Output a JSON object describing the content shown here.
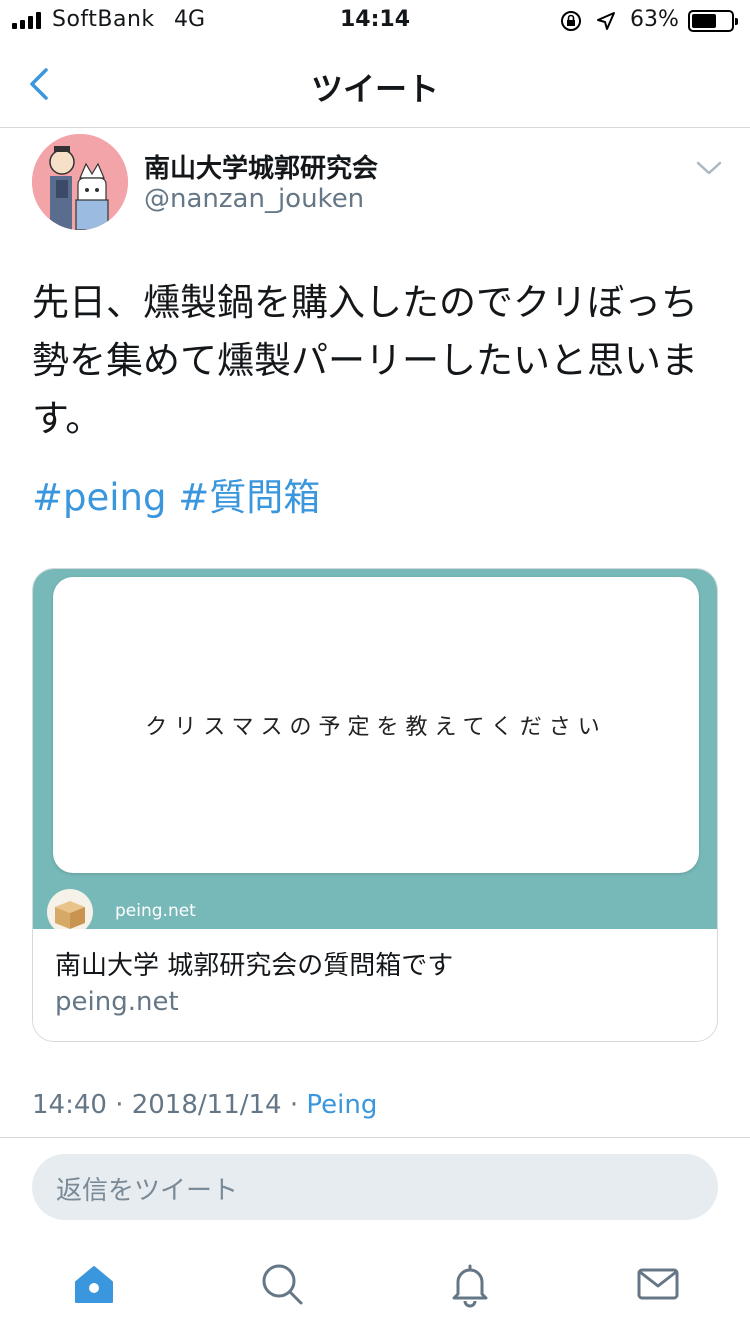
{
  "status_bar": {
    "carrier": "SoftBank",
    "network": "4G",
    "time": "14:14",
    "battery_percent": "63%",
    "battery_level": 0.63
  },
  "nav": {
    "title": "ツイート",
    "back_icon": "chevron-left-icon"
  },
  "tweet": {
    "display_name": "南山大学城郭研究会",
    "screen_name": "@nanzan_jouken",
    "text": "先日、燻製鍋を購入したのでクリぼっち勢を集めて燻製パーリーしたいと思います。",
    "hashtags": [
      "#peing",
      "#質問箱"
    ],
    "timestamp": "14:40 · 2018/11/14 · ",
    "source": "Peing"
  },
  "card": {
    "question": "クリスマスの予定を教えてください",
    "site_label": "peing.net",
    "title": "南山大学 城郭研究会の質問箱です",
    "domain": "peing.net"
  },
  "reply": {
    "placeholder": "返信をツイート"
  },
  "tabbar": {
    "items": [
      "home-icon",
      "search-icon",
      "notifications-icon",
      "messages-icon"
    ]
  },
  "colors": {
    "accent": "#3a96dd",
    "muted": "#657786",
    "card_teal": "#77b8b8"
  }
}
